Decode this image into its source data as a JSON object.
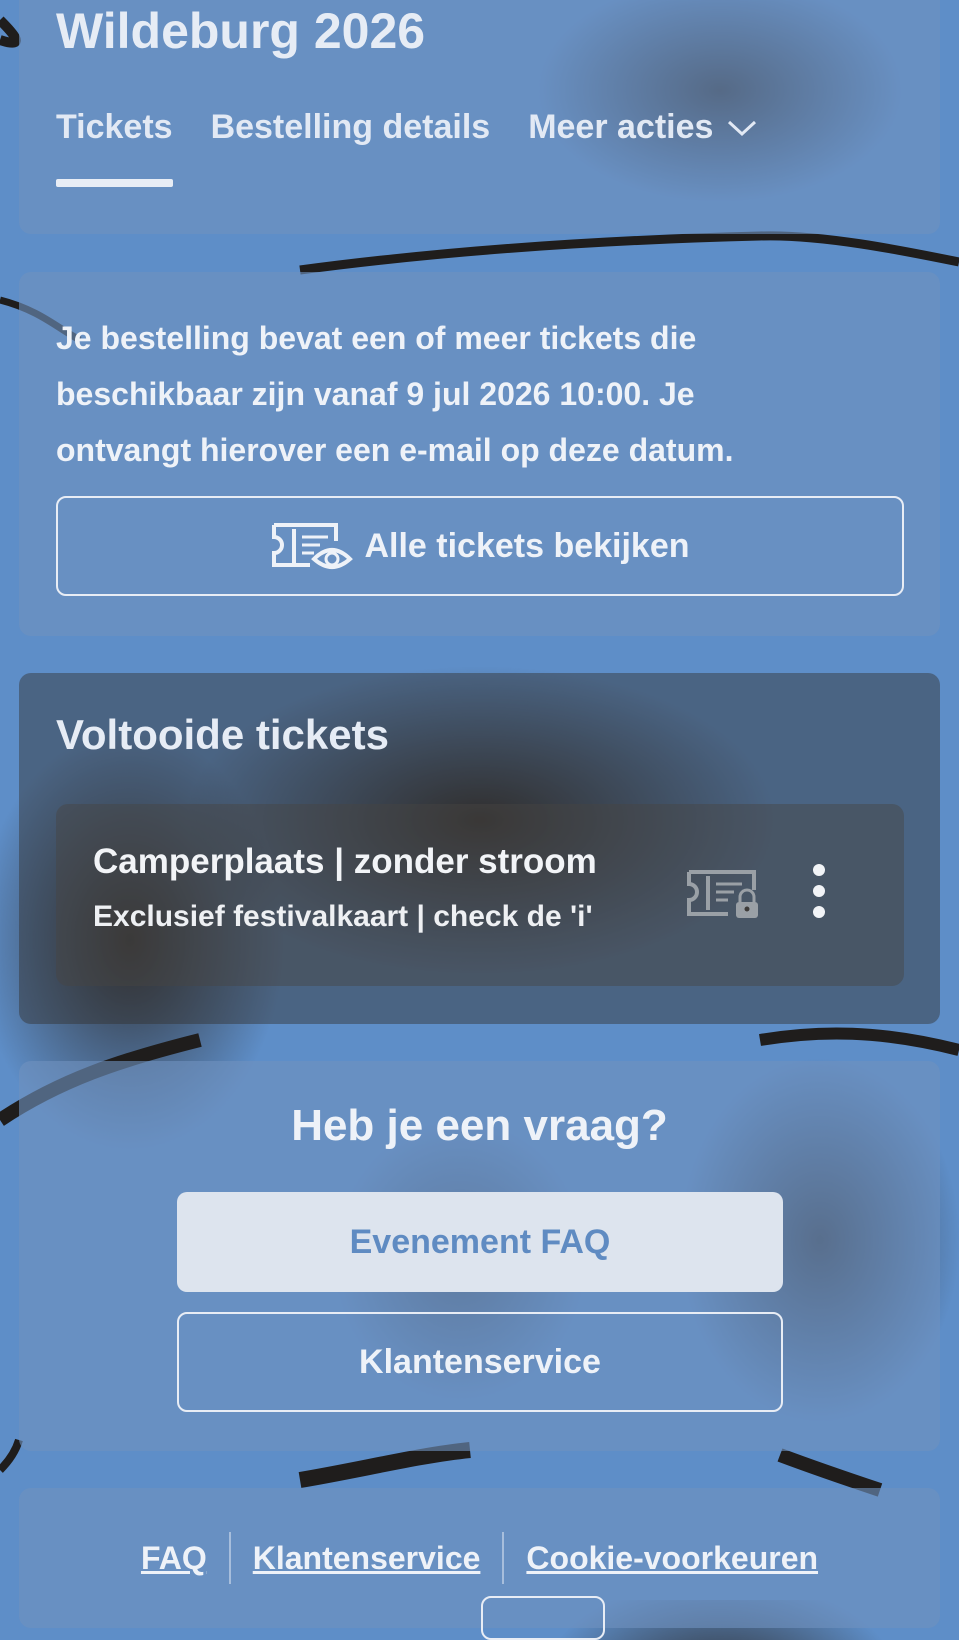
{
  "event": {
    "title": "Wildeburg 2026"
  },
  "tabs": [
    {
      "label": "Tickets",
      "active": true
    },
    {
      "label": "Bestelling details",
      "active": false
    },
    {
      "label": "Meer acties",
      "active": false,
      "icon": "chevron-down-icon"
    }
  ],
  "info": {
    "message": "Je bestelling bevat een of meer tickets die beschikbaar zijn vanaf 9 jul 2026 10:00. Je ontvangt hierover een e-mail op deze datum.",
    "view_all_label": "Alle tickets bekijken",
    "view_all_icon": "ticket-eye-icon"
  },
  "completed": {
    "title": "Voltooide tickets",
    "tickets": [
      {
        "name": "Camperplaats | zonder stroom",
        "subtitle": "Exclusief festivalkaart | check de 'i'",
        "status_icon": "ticket-lock-icon",
        "menu_icon": "more-vertical-icon"
      }
    ]
  },
  "question": {
    "title": "Heb je een vraag?",
    "faq_label": "Evenement FAQ",
    "service_label": "Klantenservice"
  },
  "footer": {
    "links": [
      "FAQ",
      "Klantenservice",
      "Cookie-voorkeuren"
    ]
  },
  "colors": {
    "background": "#5e8ec8",
    "card": "#7092be",
    "text": "#eef2f8",
    "faq_button_bg": "#dde4ee",
    "faq_button_text": "#5f8bc2"
  }
}
